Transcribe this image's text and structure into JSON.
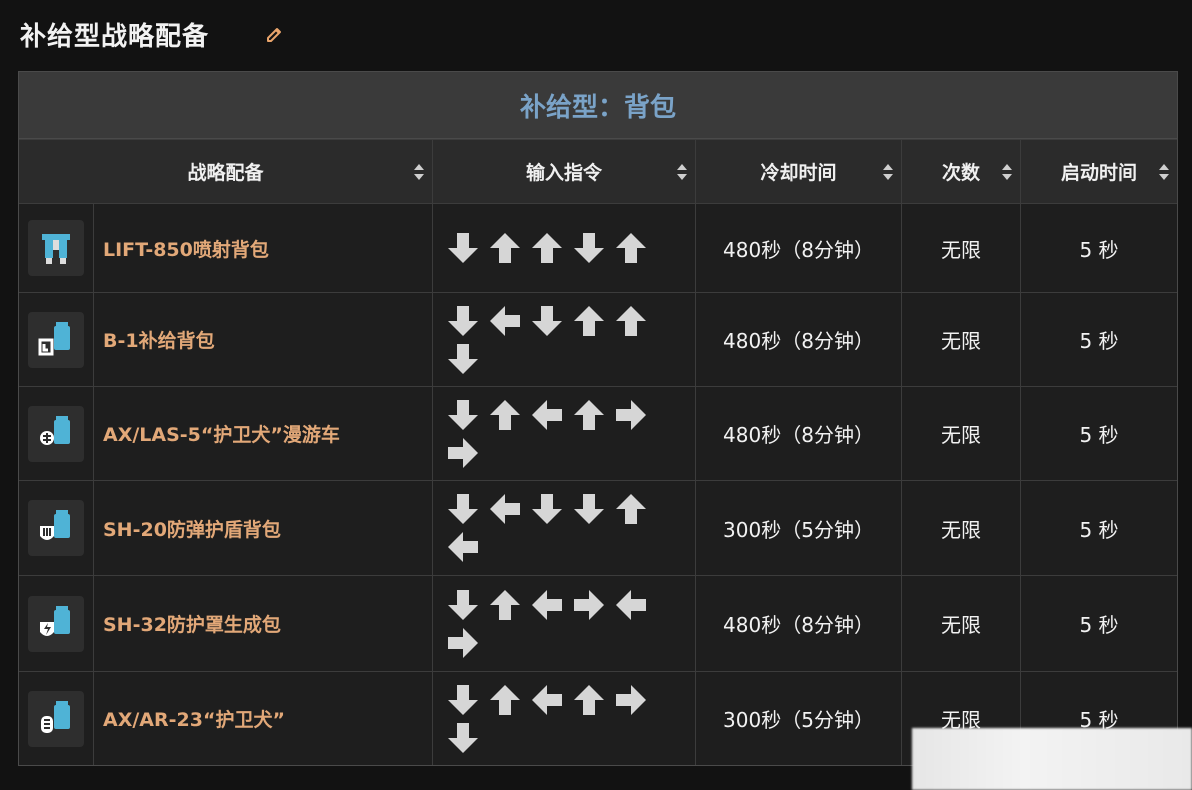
{
  "page": {
    "title": "补给型战略配备"
  },
  "table": {
    "caption": "补给型：背包",
    "headers": {
      "stratagem": "战略配备",
      "input": "输入指令",
      "cooldown": "冷却时间",
      "uses": "次数",
      "activation": "启动时间"
    },
    "rows": [
      {
        "name": "LIFT-850喷射背包",
        "icon": "jetpack-icon",
        "input": [
          "down",
          "up",
          "up",
          "down",
          "up"
        ],
        "cooldown": "480秒（8分钟）",
        "uses": "无限",
        "activation": "5 秒"
      },
      {
        "name": "B-1补给背包",
        "icon": "supply-pack-icon",
        "input": [
          "down",
          "left",
          "down",
          "up",
          "up",
          "down"
        ],
        "cooldown": "480秒（8分钟）",
        "uses": "无限",
        "activation": "5 秒"
      },
      {
        "name": "AX/LAS-5“护卫犬”漫游车",
        "icon": "rover-icon",
        "input": [
          "down",
          "up",
          "left",
          "up",
          "right",
          "right"
        ],
        "cooldown": "480秒（8分钟）",
        "uses": "无限",
        "activation": "5 秒"
      },
      {
        "name": "SH-20防弹护盾背包",
        "icon": "ballistic-shield-icon",
        "input": [
          "down",
          "left",
          "down",
          "down",
          "up",
          "left"
        ],
        "cooldown": "300秒（5分钟）",
        "uses": "无限",
        "activation": "5 秒"
      },
      {
        "name": "SH-32防护罩生成包",
        "icon": "shield-generator-icon",
        "input": [
          "down",
          "up",
          "left",
          "right",
          "left",
          "right"
        ],
        "cooldown": "480秒（8分钟）",
        "uses": "无限",
        "activation": "5 秒"
      },
      {
        "name": "AX/AR-23“护卫犬”",
        "icon": "guard-dog-icon",
        "input": [
          "down",
          "up",
          "left",
          "up",
          "right",
          "down"
        ],
        "cooldown": "300秒（5分钟）",
        "uses": "无限",
        "activation": "5 秒"
      }
    ]
  },
  "colors": {
    "name": "#e2a878",
    "caption": "#7aa3c8",
    "icon_blue": "#4fb3d6",
    "edit": "#e9a46b"
  }
}
